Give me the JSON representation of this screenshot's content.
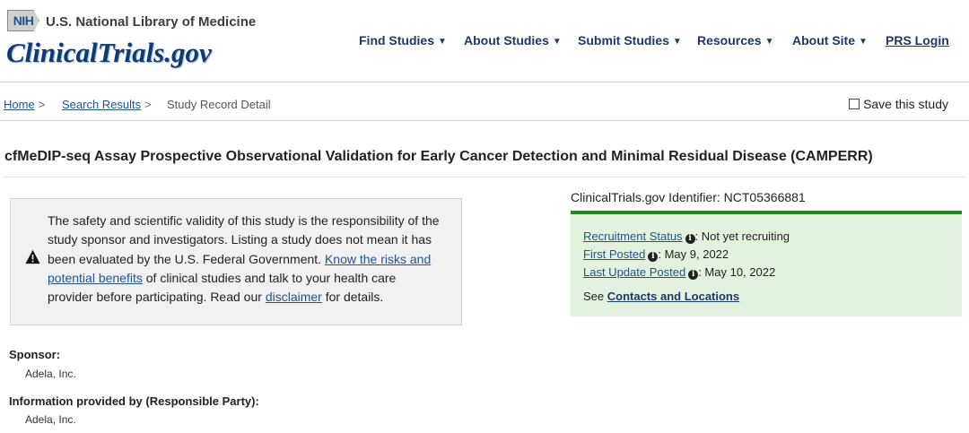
{
  "header": {
    "nih_badge": "NIH",
    "nlm_text": "U.S. National Library of Medicine",
    "site_logo": "ClinicalTrials.gov",
    "nav": [
      {
        "label": "Find Studies",
        "caret": "▼"
      },
      {
        "label": "About Studies",
        "caret": "▼"
      },
      {
        "label": "Submit Studies",
        "caret": "▼"
      },
      {
        "label": "Resources",
        "caret": "▼"
      },
      {
        "label": "About Site",
        "caret": "▼"
      },
      {
        "label": "PRS Login"
      }
    ]
  },
  "breadcrumb": {
    "items": [
      {
        "label": "Home",
        "sep": ">"
      },
      {
        "label": "Search Results",
        "sep": ">"
      },
      {
        "label": "Study Record Detail"
      }
    ]
  },
  "save_study": {
    "label": "Save this study",
    "checked": false
  },
  "study": {
    "title": "cfMeDIP-seq Assay Prospective Observational Validation for Early Cancer Detection and Minimal Residual Disease (CAMPERR)"
  },
  "disclaimer": {
    "text_1": "The safety and scientific validity of this study is the responsibility of the study sponsor and investigators. Listing a study does not mean it has been evaluated by the U.S. Federal Government. ",
    "link_1": "Know the risks and potential benefits",
    "text_2": " of clinical studies and talk to your health care provider before participating. Read our ",
    "link_2": "disclaimer",
    "text_3": " for details.",
    "icon": "warning-triangle-icon"
  },
  "identifier": {
    "label": "ClinicalTrials.gov Identifier: ",
    "value": "NCT05366881"
  },
  "status": {
    "recruitment_label": "Recruitment Status",
    "recruitment_value": ": Not yet recruiting",
    "first_posted_label": "First Posted",
    "first_posted_value": ": May 9, 2022",
    "last_update_label": "Last Update Posted",
    "last_update_value": ": May 10, 2022",
    "see_text": "See ",
    "contacts_link": "Contacts and Locations",
    "info_glyph": "i",
    "accent_color": "#1e8a1e",
    "background_color": "#e3f2df"
  },
  "sponsor": {
    "label": "Sponsor:",
    "value": "Adela, Inc."
  },
  "responsible_party": {
    "label": "Information provided by (Responsible Party):",
    "value": "Adela, Inc."
  }
}
